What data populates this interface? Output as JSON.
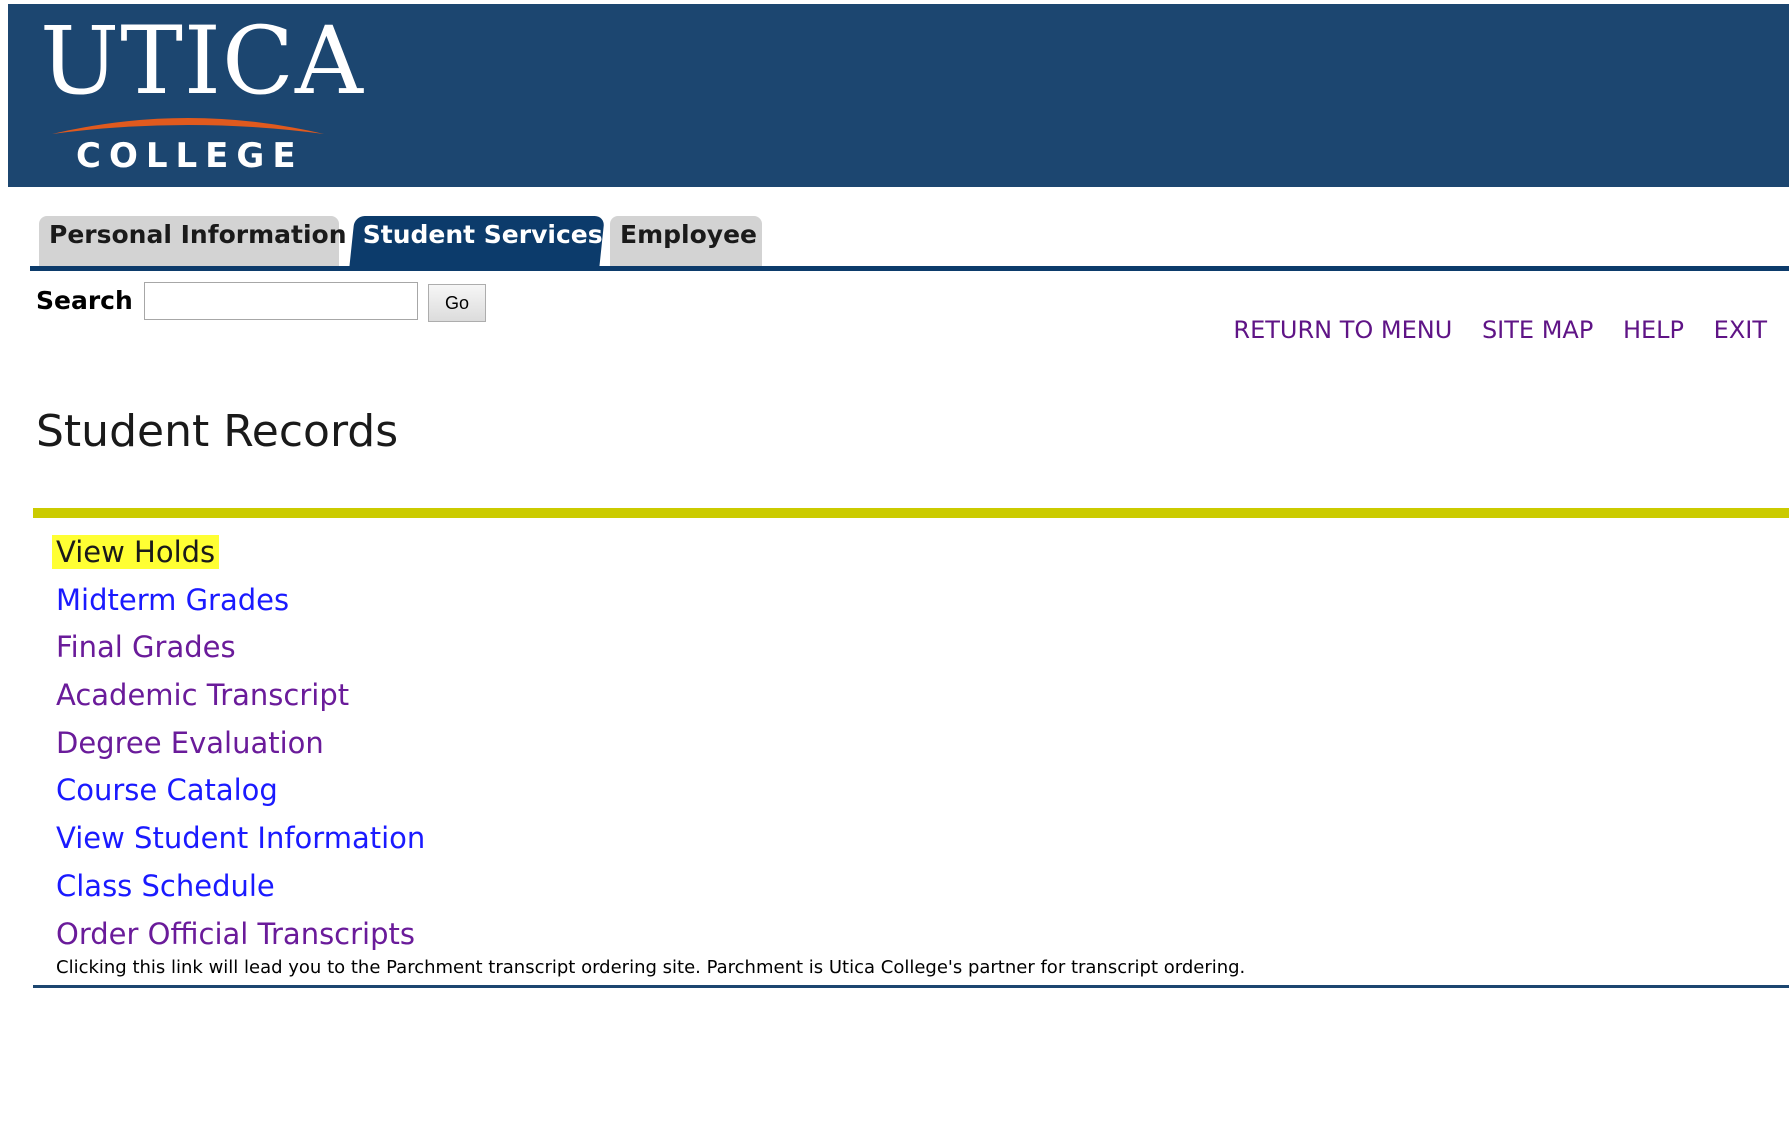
{
  "logo": {
    "word": "UTICA",
    "sub": "COLLEGE"
  },
  "tabs": [
    {
      "label": "Personal Information",
      "active": false
    },
    {
      "label": "Student Services",
      "active": true
    },
    {
      "label": "Employee",
      "active": false
    }
  ],
  "search": {
    "label": "Search",
    "value": "",
    "button_label": "Go"
  },
  "util_links": [
    "RETURN TO MENU",
    "SITE MAP",
    "HELP",
    "EXIT"
  ],
  "page_title": "Student Records",
  "menu_items": [
    {
      "label": "View Holds",
      "highlighted": true
    },
    {
      "label": "Midterm Grades"
    },
    {
      "label": "Final Grades"
    },
    {
      "label": "Academic Transcript"
    },
    {
      "label": "Degree Evaluation"
    },
    {
      "label": "Course Catalog"
    },
    {
      "label": "View Student Information"
    },
    {
      "label": "Class Schedule"
    },
    {
      "label": "Order Official Transcripts"
    }
  ],
  "menu_note": "Clicking this link will lead you to the Parchment transcript ordering site. Parchment is Utica College's partner for transcript ordering.",
  "colors": {
    "banner": "#1c4670",
    "active_tab": "#0c3b6b",
    "title_rule": "#cbcb00",
    "highlight": "#ffff33",
    "visited_link": "#6a1b9a",
    "unvisited_link": "#1a1aff",
    "logo_swoosh": "#e05a1e"
  }
}
